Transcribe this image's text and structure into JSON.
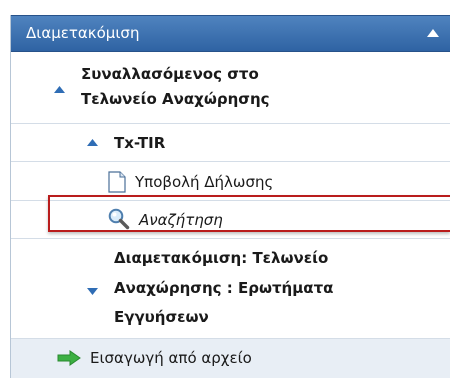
{
  "menu": {
    "header_title": "Διαμετακόμιση",
    "items": [
      {
        "label": "Συναλλασόμενος στο",
        "label2": "Τελωνείο Αναχώρησης",
        "state": "expanded"
      },
      {
        "label": "Tx-TIR",
        "state": "expanded"
      },
      {
        "label": "Υποβολή Δήλωσης",
        "icon": "document-icon"
      },
      {
        "label": "Αναζήτηση",
        "icon": "search-icon",
        "highlighted": true
      },
      {
        "label": "Διαμετακόμιση: Τελωνείο",
        "label2": "Αναχώρησης : Ερωτήματα",
        "label3": "Εγγυήσεων",
        "state": "collapsed"
      },
      {
        "label": "Εισαγωγή από αρχείο",
        "icon": "arrow-right-icon"
      }
    ]
  },
  "colors": {
    "header_bg": "#3a6fb0",
    "triangle": "#2f6db5",
    "highlight_border": "#b91c1c",
    "arrow_green": "#3cb043"
  }
}
